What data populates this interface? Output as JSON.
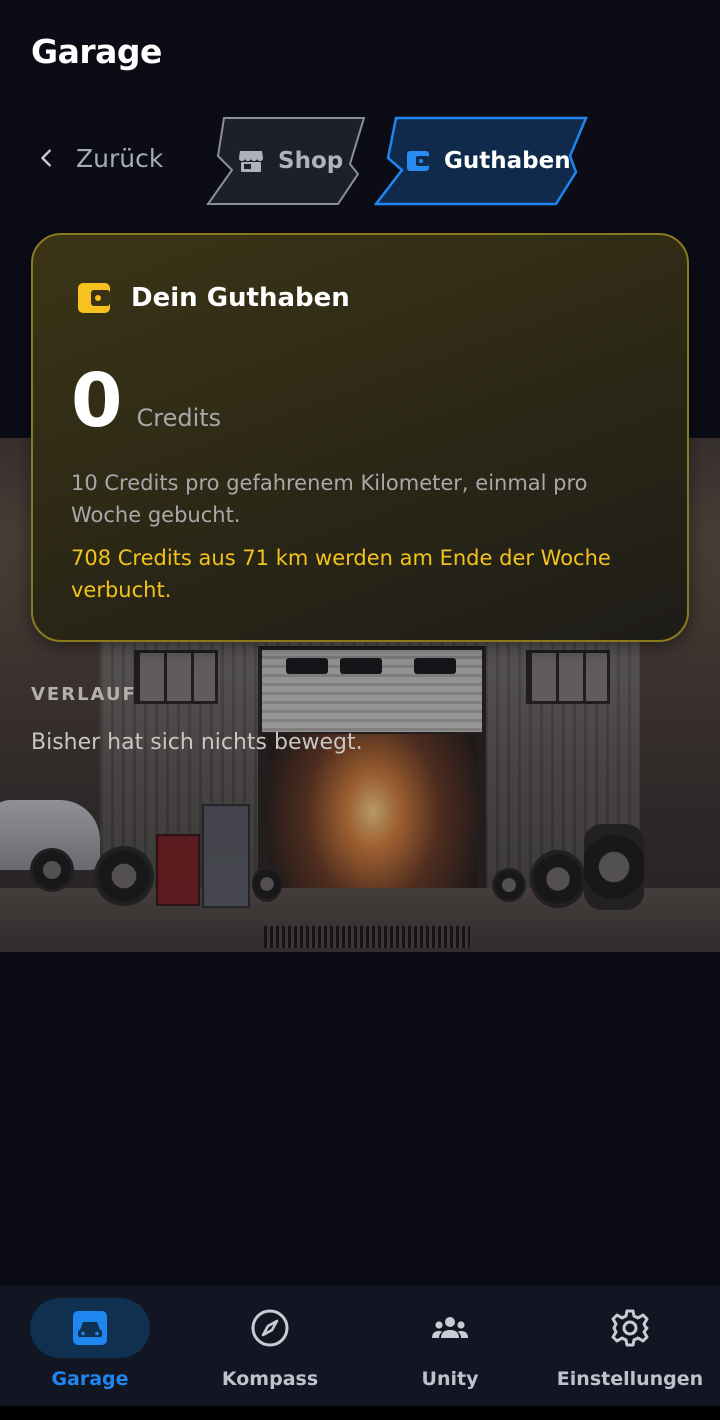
{
  "header": {
    "title": "Garage"
  },
  "topnav": {
    "back_label": "Zurück",
    "tabs": [
      {
        "label": "Shop",
        "icon": "store-icon",
        "active": false
      },
      {
        "label": "Guthaben",
        "icon": "wallet-icon",
        "active": true
      }
    ]
  },
  "balance_card": {
    "title": "Dein Guthaben",
    "icon": "wallet-icon",
    "value": "0",
    "unit": "Credits",
    "info": "10 Credits pro gefahrenem Kilometer, einmal pro Woche gebucht.",
    "pending": "708 Credits aus 71 km werden am Ende der Woche verbucht."
  },
  "history": {
    "heading": "VERLAUF",
    "empty_text": "Bisher hat sich nichts bewegt."
  },
  "bottom_nav": {
    "items": [
      {
        "label": "Garage",
        "icon": "car-icon",
        "active": true
      },
      {
        "label": "Kompass",
        "icon": "compass-icon",
        "active": false
      },
      {
        "label": "Unity",
        "icon": "group-icon",
        "active": false
      },
      {
        "label": "Einstellungen",
        "icon": "gear-icon",
        "active": false
      }
    ]
  },
  "colors": {
    "background": "#0b0c16",
    "accent_blue": "#1f86f0",
    "gold": "#f3c21b",
    "card_border": "#8a7a1e"
  }
}
